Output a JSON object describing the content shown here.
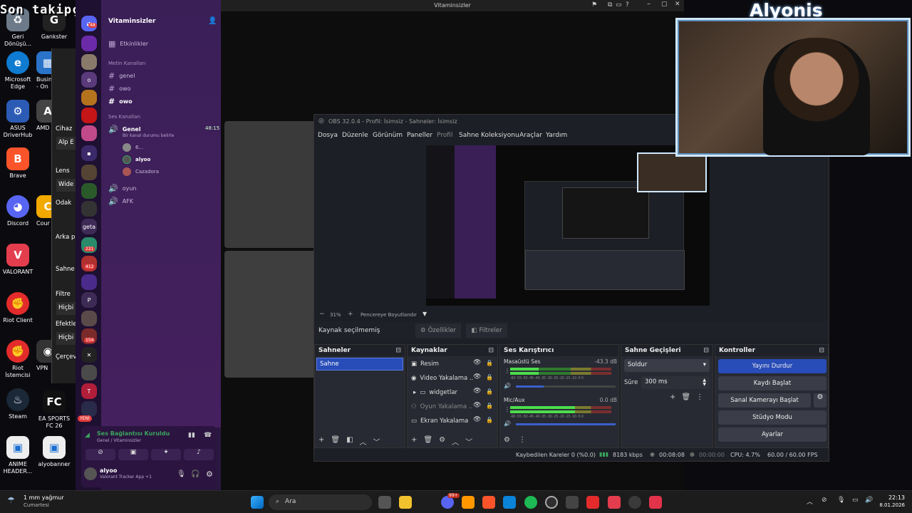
{
  "overlay": {
    "last_follower": "Son takipçi: Erocreed",
    "streamer_name": "Alyonis"
  },
  "desktop_icons": [
    {
      "label": "Geri\nDönüşü...",
      "icon": "recycle-bin-icon",
      "color": "#6c7a89"
    },
    {
      "label": "Gankster",
      "icon": "gankster-icon",
      "color": "#222"
    },
    {
      "label": "Microsoft\nEdge",
      "icon": "edge-icon",
      "color": "#0f7bd1"
    },
    {
      "label": "Busin\n- On",
      "icon": "business-icon",
      "color": "#2a73c9"
    },
    {
      "label": "ASUS\nDriverHub",
      "icon": "asus-icon",
      "color": "#2b5bb5"
    },
    {
      "label": "AMD",
      "icon": "amd-icon",
      "color": "#444"
    },
    {
      "label": "Brave",
      "icon": "brave-icon",
      "color": "#fb542b"
    },
    {
      "label": "Discord",
      "icon": "discord-icon",
      "color": "#5865f2"
    },
    {
      "label": "Cour",
      "icon": "courier-icon",
      "color": "#f2a900"
    },
    {
      "label": "VALORANT",
      "icon": "valorant-icon",
      "color": "#e43d4e"
    },
    {
      "label": "Riot Client",
      "icon": "riot-client-icon",
      "color": "#e42b2b"
    },
    {
      "label": "Riot İstemcisi",
      "icon": "riot-client-icon",
      "color": "#e42b2b"
    },
    {
      "label": "VPN",
      "icon": "vpn-icon",
      "color": "#333"
    },
    {
      "label": "Steam",
      "icon": "steam-icon",
      "color": "#1b2838"
    },
    {
      "label": "EA SPORTS\nFC 26",
      "icon": "ea-fc-icon",
      "color": "#111"
    },
    {
      "label": "ANIME\nHEADER...",
      "icon": "image-file-icon",
      "color": "#eee"
    },
    {
      "label": "alyobanner",
      "icon": "image-file-icon",
      "color": "#eee"
    }
  ],
  "camera_settings_fragment": {
    "labels": [
      "Cihaz",
      "Alp E",
      "Lens",
      "Wide",
      "Odak",
      "Arka pl",
      "Sahne",
      "Filtre",
      "Hiçbi",
      "Efektle",
      "Hiçbi",
      "Çerçev"
    ]
  },
  "discord": {
    "server_name": "Vitaminsizler",
    "events": "Etkinlikler",
    "text_section": "Metin Kanalları",
    "text_channels": [
      "genel",
      "owo",
      "owo"
    ],
    "voice_section": "Ses Kanalları",
    "voice_channel": "Genel",
    "voice_time": "48:15",
    "voice_status": "Bir kanal durumu belirle",
    "voice_users": [
      "6...",
      "alyoo",
      "Cazadora"
    ],
    "other_voice": [
      "oyun",
      "AFK"
    ],
    "guild_badges": [
      "48",
      "5",
      "221",
      "412",
      "5",
      "154"
    ],
    "guild_labels": [
      "o",
      "geta",
      "P",
      "T"
    ],
    "new_label": "YENİ",
    "connection_title": "Ses Bağlantısı Kuruldu",
    "connection_sub": "Genel / Vitaminsizler",
    "user_name": "alyoo",
    "user_status": "Valorant Tracker App +1"
  },
  "window_title": "Vitaminsizler",
  "obs": {
    "title": "OBS 32.0.4 - Profil: İsimsiz - Sahneler: İsimsiz",
    "menu": [
      "Dosya",
      "Düzenle",
      "Görünüm",
      "Paneller",
      "Profil",
      "Sahne Koleksiyonu",
      "Araçlar",
      "Yardım"
    ],
    "zoom": "31%",
    "zoom_mode": "Pencereye Boyutlandır",
    "no_source": "Kaynak seçilmemiş",
    "properties": "Özellikler",
    "filters": "Filtreler",
    "scenes_title": "Sahneler",
    "scenes": [
      "Sahne"
    ],
    "sources_title": "Kaynaklar",
    "sources": [
      {
        "name": "Resim",
        "icon": "image-icon"
      },
      {
        "name": "Video Yakalama ..",
        "icon": "camera-icon"
      },
      {
        "name": "widgetlar",
        "icon": "folder-icon"
      },
      {
        "name": "Oyun Yakalama ..",
        "icon": "gamepad-icon"
      },
      {
        "name": "Ekran Yakalama",
        "icon": "monitor-icon"
      }
    ],
    "mixer_title": "Ses Karıştırıcı",
    "mixer": [
      {
        "name": "Masaüstü Ses",
        "db": "-43.3 dB",
        "level": 0.28
      },
      {
        "name": "Mic/Aux",
        "db": "0.0 dB",
        "level": 0.64
      }
    ],
    "meter_ticks": "-60 -55 -50 -45 -40 -35 -30 -25 -20 -15 -10 -5 0",
    "transitions_title": "Sahne Geçişleri",
    "transition": "Soldur",
    "duration_label": "Süre",
    "duration": "300 ms",
    "controls_title": "Kontroller",
    "controls": [
      "Yayını Durdur",
      "Kaydı Başlat",
      "Sanal Kamerayı Başlat",
      "Stüdyo Modu",
      "Ayarlar"
    ],
    "status": {
      "dropped": "Kaybedilen Kareler 0 (%0.0)",
      "bitrate": "8183 kbps",
      "stream_time": "00:08:08",
      "rec_time": "00:00:00",
      "cpu": "CPU: 4.7%",
      "fps": "60.00 / 60.00 FPS"
    }
  },
  "taskbar": {
    "weather": "1 mm yağmur",
    "weather_sub": "Cumartesi",
    "search": "Ara",
    "time": "22:13",
    "date": "8.01.2026",
    "badge": "99+"
  },
  "colors": {
    "discord_bg": "#2a1740",
    "obs_accent": "#284cb8",
    "obs_bg": "#1d1f26"
  }
}
